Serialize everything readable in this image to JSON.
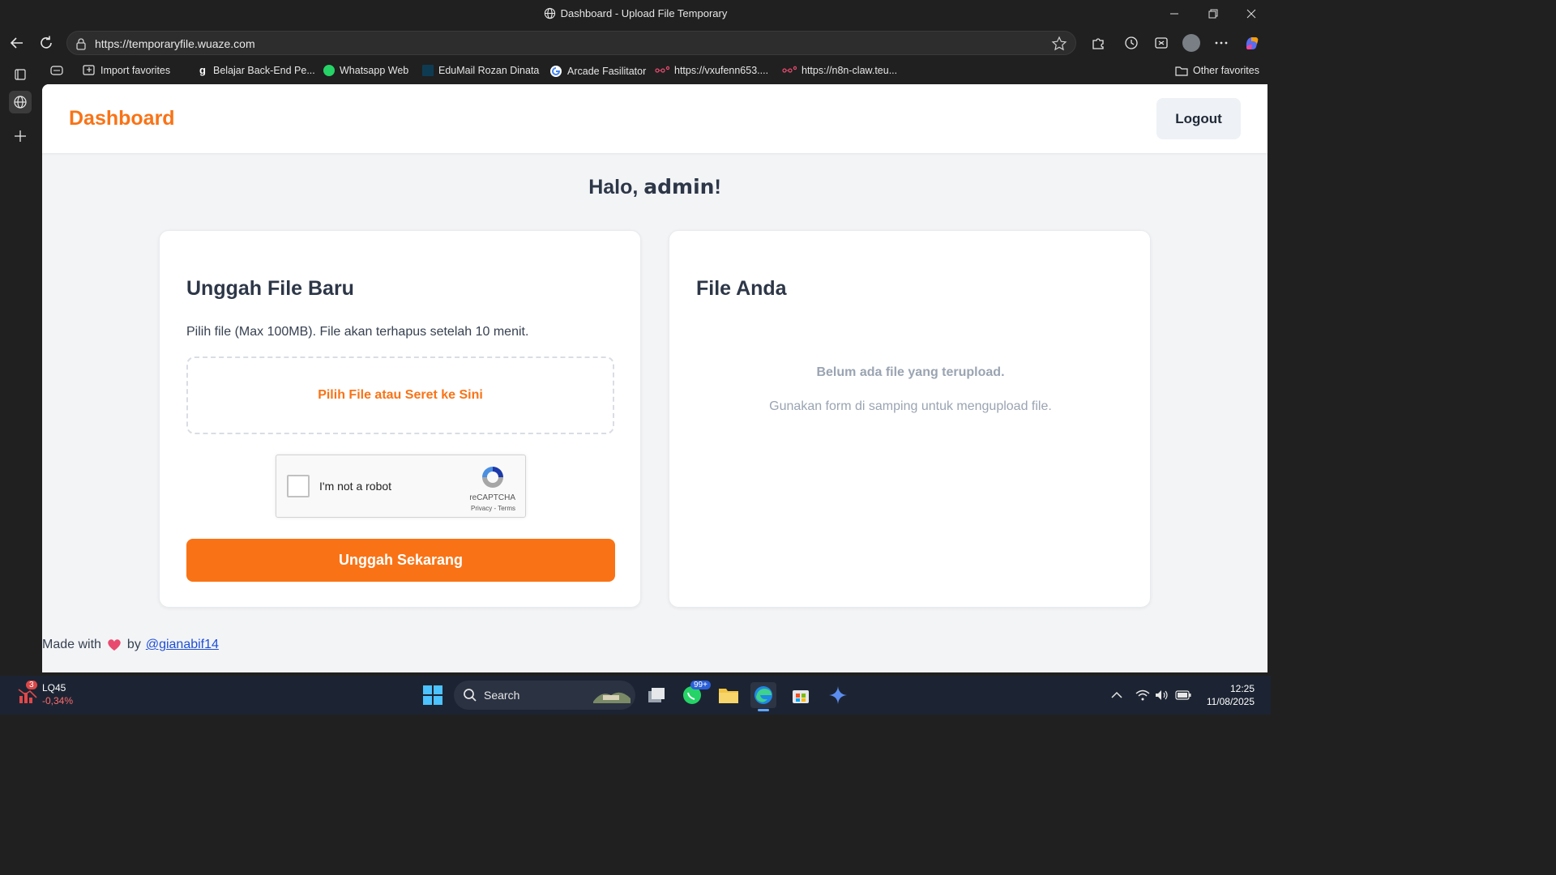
{
  "window": {
    "title": "Dashboard - Upload File Temporary"
  },
  "browser": {
    "url": "https://temporaryfile.wuaze.com",
    "favorites": [
      {
        "label": "Import favorites",
        "icon": "import-icon"
      },
      {
        "label": "Belajar Back-End Pe...",
        "icon": "dicoding-icon"
      },
      {
        "label": "Whatsapp Web",
        "icon": "whatsapp-icon"
      },
      {
        "label": "EduMail Rozan Dinata",
        "icon": "edumail-icon"
      },
      {
        "label": "Arcade Fasilitator",
        "icon": "google-icon"
      },
      {
        "label": "https://vxufenn653....",
        "icon": "n8n-icon"
      },
      {
        "label": "https://n8n-claw.teu...",
        "icon": "n8n-icon"
      }
    ],
    "other_favorites": "Other favorites"
  },
  "app": {
    "brand": "Dashboard",
    "logout_label": "Logout",
    "greeting_prefix": "Halo, ",
    "greeting_user": "admin",
    "greeting_suffix": "!",
    "upload_card": {
      "title": "Unggah File Baru",
      "description": "Pilih file (Max 100MB). File akan terhapus setelah 10 menit.",
      "dropzone_label": "Pilih File atau Seret ke Sini",
      "submit_label": "Unggah Sekarang"
    },
    "recaptcha": {
      "label": "I'm not a robot",
      "brand": "reCAPTCHA",
      "privacy": "Privacy",
      "separator": " - ",
      "terms": "Terms"
    },
    "files_card": {
      "title": "File Anda",
      "empty_title": "Belum ada file yang terupload.",
      "empty_hint": "Gunakan form di samping untuk mengupload file."
    },
    "footer": {
      "made_with": "Made with",
      "by": "by",
      "author": "@gianabif14"
    }
  },
  "taskbar": {
    "stock_symbol": "LQ45",
    "stock_change": "-0,34%",
    "stock_badge": "3",
    "search_label": "Search",
    "whatsapp_badge": "99+",
    "time": "12:25",
    "date": "11/08/2025"
  },
  "colors": {
    "accent": "#f97316",
    "link": "#1d4ed8"
  }
}
